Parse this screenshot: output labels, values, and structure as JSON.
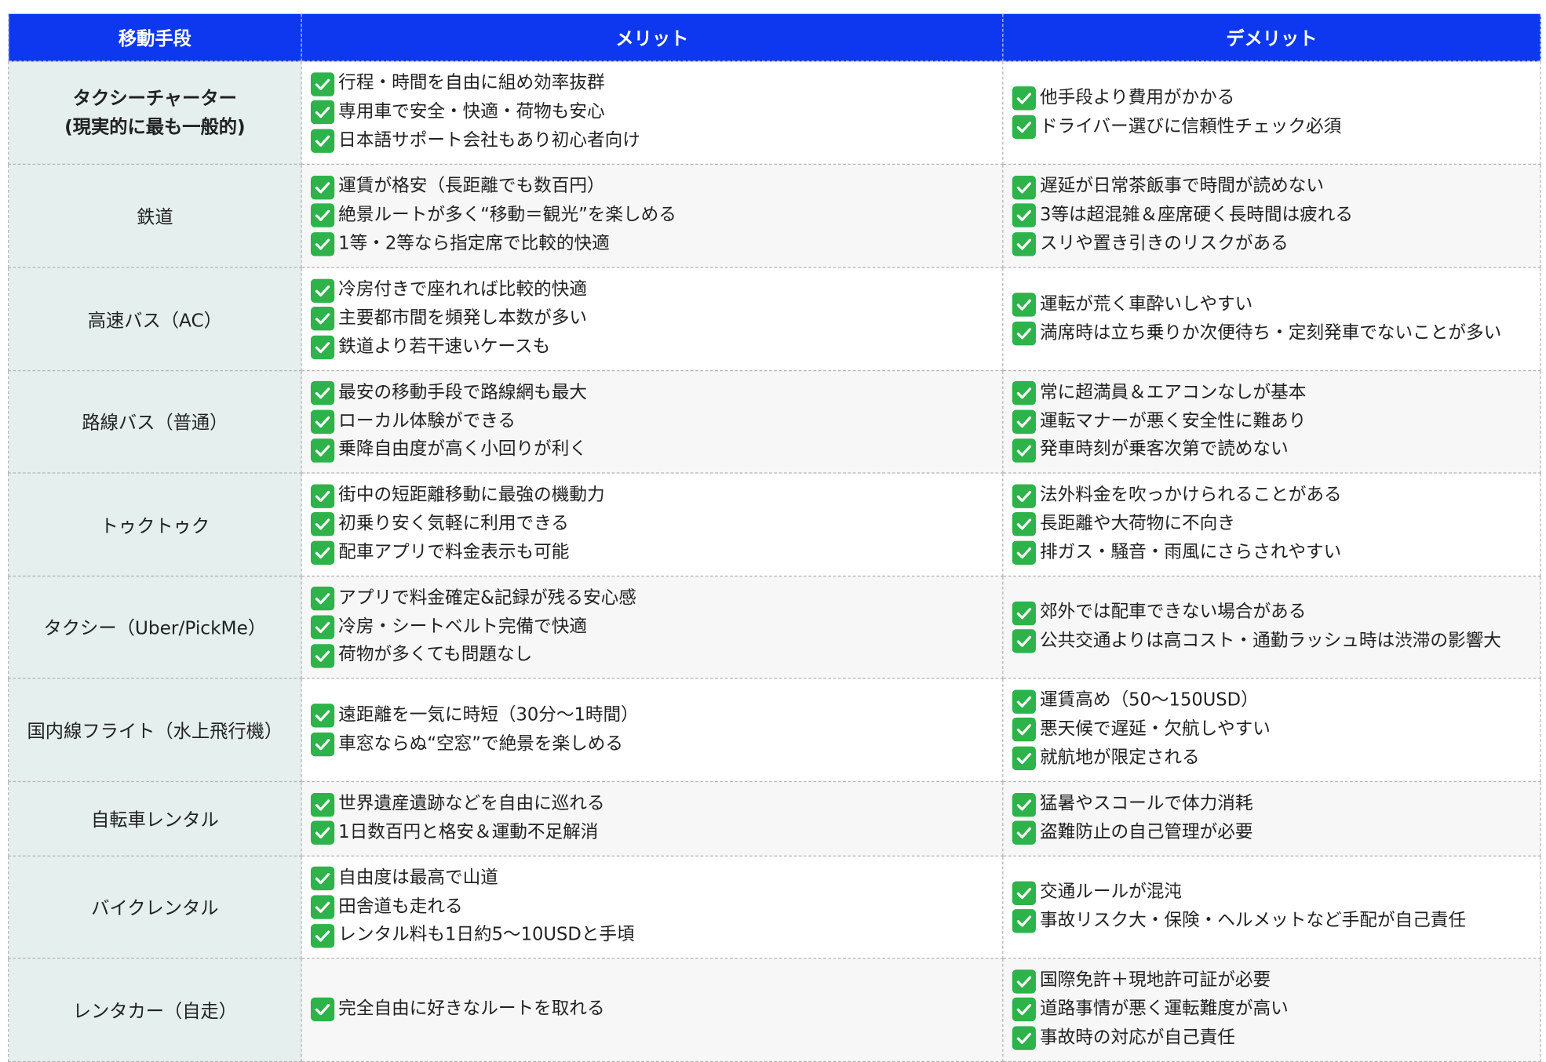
{
  "table": {
    "headers": [
      "移動手段",
      "メリット",
      "デメリット"
    ],
    "check_icon": "white-check-mark-icon",
    "check_color": "#2db34a",
    "header_color": "#0d38f0",
    "rows": [
      {
        "mode": [
          "タクシーチャーター",
          "(現実的に最も一般的)"
        ],
        "pros": [
          "行程・時間を自由に組め効率抜群",
          "専用車で安全・快適・荷物も安心",
          "日本語サポート会社もあり初心者向け"
        ],
        "cons": [
          "他手段より費用がかかる",
          "ドライバー選びに信頼性チェック必須"
        ]
      },
      {
        "mode": [
          "鉄道"
        ],
        "pros": [
          "運賃が格安（長距離でも数百円）",
          "絶景ルートが多く“移動＝観光”を楽しめる",
          "1等・2等なら指定席で比較的快適"
        ],
        "cons": [
          "遅延が日常茶飯事で時間が読めない",
          "3等は超混雑＆座席硬く長時間は疲れる",
          "スリや置き引きのリスクがある"
        ]
      },
      {
        "mode": [
          "高速バス（AC）"
        ],
        "pros": [
          "冷房付きで座れれば比較的快適",
          "主要都市間を頻発し本数が多い",
          "鉄道より若干速いケースも"
        ],
        "cons": [
          "運転が荒く車酔いしやすい",
          "満席時は立ち乗りか次便待ち・定刻発車でないことが多い"
        ]
      },
      {
        "mode": [
          "路線バス（普通）"
        ],
        "pros": [
          "最安の移動手段で路線網も最大",
          "ローカル体験ができる",
          "乗降自由度が高く小回りが利く"
        ],
        "cons": [
          "常に超満員＆エアコンなしが基本",
          "運転マナーが悪く安全性に難あり",
          "発車時刻が乗客次第で読めない"
        ]
      },
      {
        "mode": [
          "トゥクトゥク"
        ],
        "pros": [
          "街中の短距離移動に最強の機動力",
          "初乗り安く気軽に利用できる",
          "配車アプリで料金表示も可能"
        ],
        "cons": [
          "法外料金を吹っかけられることがある",
          "長距離や大荷物に不向き",
          "排ガス・騒音・雨風にさらされやすい"
        ]
      },
      {
        "mode": [
          "タクシー（Uber/PickMe）"
        ],
        "pros": [
          "アプリで料金確定&記録が残る安心感",
          "冷房・シートベルト完備で快適",
          "荷物が多くても問題なし"
        ],
        "cons": [
          "郊外では配車できない場合がある",
          "公共交通よりは高コスト・通勤ラッシュ時は渋滞の影響大"
        ]
      },
      {
        "mode": [
          "国内線フライト（水上飛行機）"
        ],
        "pros": [
          "遠距離を一気に時短（30分〜1時間）",
          "車窓ならぬ“空窓”で絶景を楽しめる"
        ],
        "cons": [
          "運賃高め（50〜150USD）",
          "悪天候で遅延・欠航しやすい",
          "就航地が限定される"
        ]
      },
      {
        "mode": [
          "自転車レンタル"
        ],
        "pros": [
          "世界遺産遺跡などを自由に巡れる",
          "1日数百円と格安＆運動不足解消"
        ],
        "cons": [
          "猛暑やスコールで体力消耗",
          "盗難防止の自己管理が必要"
        ]
      },
      {
        "mode": [
          "バイクレンタル"
        ],
        "pros": [
          "自由度は最高で山道",
          "田舎道も走れる",
          "レンタル料も1日約5〜10USDと手頃"
        ],
        "cons": [
          "交通ルールが混沌",
          "事故リスク大・保険・ヘルメットなど手配が自己責任"
        ]
      },
      {
        "mode": [
          "レンタカー（自走）"
        ],
        "pros": [
          "完全自由に好きなルートを取れる"
        ],
        "cons": [
          "国際免許＋現地許可証が必要",
          "道路事情が悪く運転難度が高い",
          "事故時の対応が自己責任"
        ]
      }
    ]
  }
}
